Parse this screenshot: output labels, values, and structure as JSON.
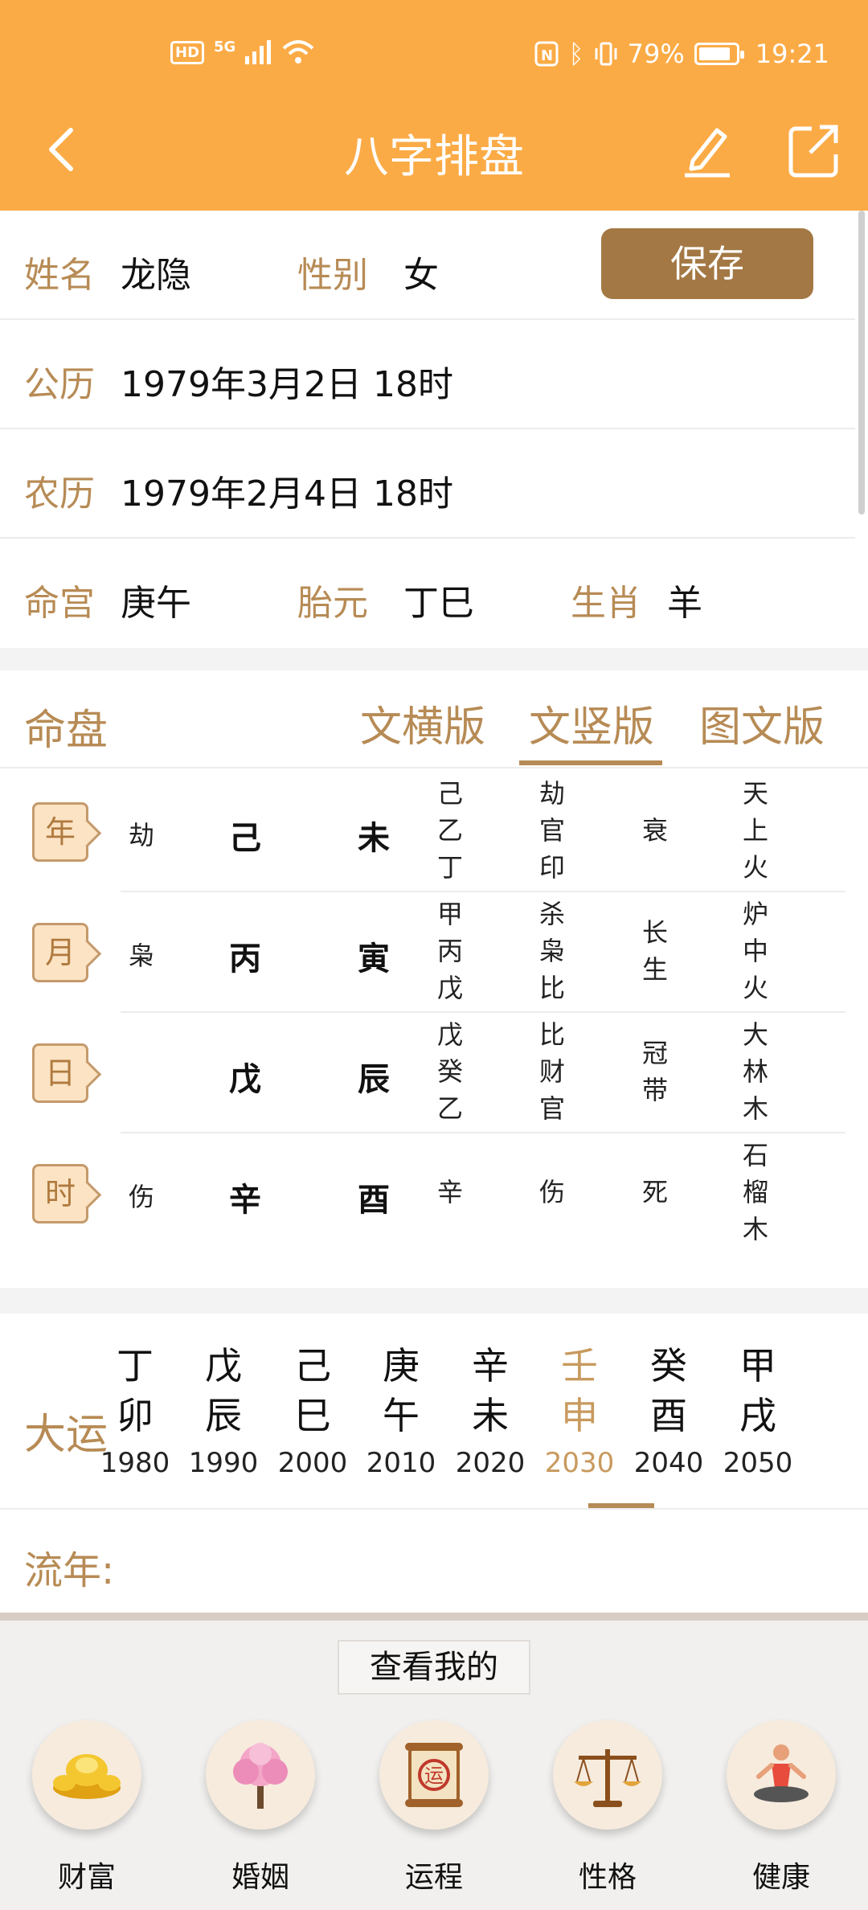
{
  "status_bar": {
    "network": "HD",
    "signal": "5G",
    "battery": "79%",
    "time": "19:21"
  },
  "header": {
    "title": "八字排盘"
  },
  "info": {
    "name_label": "姓名",
    "name": "龙隐",
    "gender_label": "性别",
    "gender": "女",
    "save_label": "保存",
    "solar_label": "公历",
    "solar": "1979年3月2日 18时",
    "lunar_label": "农历",
    "lunar": "1979年2月4日 18时",
    "minggong_label": "命宫",
    "minggong": "庚午",
    "taiyuan_label": "胎元",
    "taiyuan": "丁巳",
    "shengxiao_label": "生肖",
    "shengxiao": "羊"
  },
  "mingpan": {
    "title": "命盘",
    "tabs": [
      "文横版",
      "文竖版",
      "图文版"
    ],
    "selected_tab": "文竖版",
    "pillars": [
      {
        "tag": "年",
        "shishen": "劫",
        "gan": "己",
        "zhi": "未",
        "canggan": [
          "己",
          "乙",
          "丁"
        ],
        "canggan_shishen": [
          "劫",
          "官",
          "印"
        ],
        "changsheng": [
          "衰"
        ],
        "nayin": [
          "天",
          "上",
          "火"
        ]
      },
      {
        "tag": "月",
        "shishen": "枭",
        "gan": "丙",
        "zhi": "寅",
        "canggan": [
          "甲",
          "丙",
          "戊"
        ],
        "canggan_shishen": [
          "杀",
          "枭",
          "比"
        ],
        "changsheng": [
          "长",
          "生"
        ],
        "nayin": [
          "炉",
          "中",
          "火"
        ]
      },
      {
        "tag": "日",
        "shishen": "",
        "gan": "戊",
        "zhi": "辰",
        "canggan": [
          "戊",
          "癸",
          "乙"
        ],
        "canggan_shishen": [
          "比",
          "财",
          "官"
        ],
        "changsheng": [
          "冠",
          "带"
        ],
        "nayin": [
          "大",
          "林",
          "木"
        ]
      },
      {
        "tag": "时",
        "shishen": "伤",
        "gan": "辛",
        "zhi": "酉",
        "canggan": [
          "辛"
        ],
        "canggan_shishen": [
          "伤"
        ],
        "changsheng": [
          "死"
        ],
        "nayin": [
          "石",
          "榴",
          "木"
        ]
      }
    ]
  },
  "dayun": {
    "label": "大运",
    "items": [
      {
        "gan": "丁",
        "zhi": "卯",
        "year": "1980"
      },
      {
        "gan": "戊",
        "zhi": "辰",
        "year": "1990"
      },
      {
        "gan": "己",
        "zhi": "巳",
        "year": "2000"
      },
      {
        "gan": "庚",
        "zhi": "午",
        "year": "2010"
      },
      {
        "gan": "辛",
        "zhi": "未",
        "year": "2020"
      },
      {
        "gan": "壬",
        "zhi": "申",
        "year": "2030"
      },
      {
        "gan": "癸",
        "zhi": "酉",
        "year": "2040"
      },
      {
        "gan": "甲",
        "zhi": "戌",
        "year": "2050"
      }
    ],
    "selected_year": "2030"
  },
  "liunian": {
    "label": "流年:"
  },
  "bottom": {
    "look_label": "查看我的",
    "features": [
      {
        "label": "财富",
        "icon": "gold-ingot-icon"
      },
      {
        "label": "婚姻",
        "icon": "blossom-tree-icon"
      },
      {
        "label": "运程",
        "icon": "scroll-icon"
      },
      {
        "label": "性格",
        "icon": "scales-icon"
      },
      {
        "label": "健康",
        "icon": "yoga-icon"
      }
    ]
  },
  "colors": {
    "header": "#fbab46",
    "accent": "#b78b55",
    "save_button": "#a37844"
  }
}
